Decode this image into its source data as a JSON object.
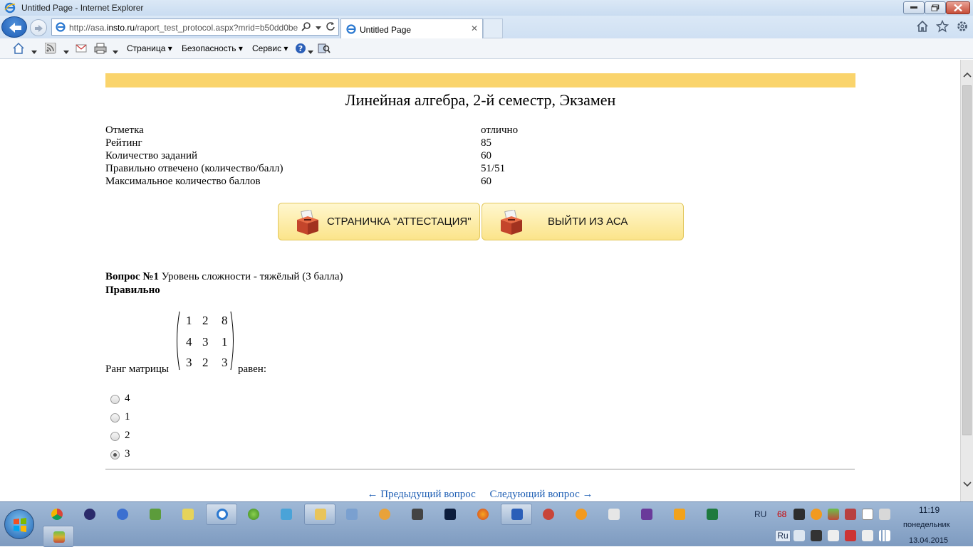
{
  "window": {
    "title": "Untitled Page - Internet Explorer"
  },
  "address_bar": {
    "url_prefix": "http://asa.",
    "url_host": "insto.ru",
    "url_rest": "/raport_test_protocol.aspx?mrid=b50dd0be"
  },
  "tab": {
    "label": "Untitled Page",
    "close": "✕"
  },
  "command_bar": {
    "page": "Страница",
    "safety": "Безопасность",
    "tools": "Сервис"
  },
  "page": {
    "title": "Линейная алгебра, 2-й семестр, Экзамен",
    "summary": [
      {
        "label": "Отметка",
        "value": "отлично"
      },
      {
        "label": "Рейтинг",
        "value": "85"
      },
      {
        "label": "Количество заданий",
        "value": "60"
      },
      {
        "label": "Правильно отвечено (количество/балл)",
        "value": "51/51"
      },
      {
        "label": "Максимальное количество баллов",
        "value": "60"
      }
    ],
    "buttons": {
      "attestation": "СТРАНИЧКА \"АТТЕСТАЦИЯ\"",
      "exit": "ВЫЙТИ ИЗ АСА"
    },
    "question": {
      "number_label": "Вопрос №1",
      "difficulty": "Уровень сложности - тяжёлый (3 балла)",
      "status": "Правильно",
      "text_before": "Ранг матрицы",
      "text_after": "равен:",
      "matrix": [
        [
          "1",
          "2",
          "8"
        ],
        [
          "4",
          "3",
          "1"
        ],
        [
          "3",
          "2",
          "3"
        ]
      ],
      "options": [
        "4",
        "1",
        "2",
        "3"
      ],
      "selected_index": 3
    },
    "nav": {
      "prev": "← Предыдущий вопрос",
      "next": "Следующий вопрос →"
    }
  },
  "taskbar": {
    "lang_top": "RU",
    "lang_bottom": "Ru",
    "tray_number": "68",
    "time": "11:19",
    "day": "понедельник",
    "date": "13.04.2015"
  },
  "colors": {
    "accent_band": "#fad46c",
    "link": "#1f5fb4"
  }
}
